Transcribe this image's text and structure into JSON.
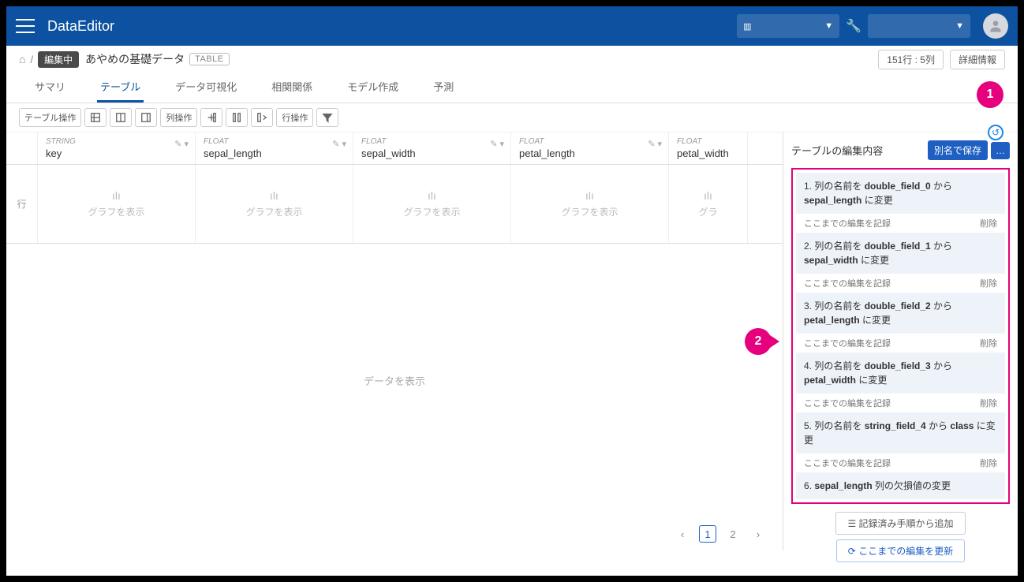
{
  "app": {
    "title": "DataEditor"
  },
  "breadcrumb": {
    "editing": "編集中",
    "dataset": "あやめの基礎データ",
    "type_badge": "TABLE"
  },
  "header_right": {
    "rowcol": "151行 : 5列",
    "detail": "詳細情報"
  },
  "tabs": {
    "summary": "サマリ",
    "table": "テーブル",
    "viz": "データ可視化",
    "corr": "相関関係",
    "model": "モデル作成",
    "predict": "予測"
  },
  "toolbar": {
    "table_ops": "テーブル操作",
    "col_ops": "列操作",
    "row_ops": "行操作"
  },
  "columns": [
    {
      "type": "STRING",
      "name": "key"
    },
    {
      "type": "FLOAT",
      "name": "sepal_length"
    },
    {
      "type": "FLOAT",
      "name": "sepal_width"
    },
    {
      "type": "FLOAT",
      "name": "petal_length"
    },
    {
      "type": "FLOAT",
      "name": "petal_width"
    }
  ],
  "row_label": "行",
  "graph_label": "グラフを表示",
  "data_placeholder": "データを表示",
  "side": {
    "title": "テーブルの編集内容",
    "save_as": "別名で保存",
    "more": "…",
    "record": "ここまでの編集を記録",
    "delete": "削除",
    "history": [
      {
        "n": "1.",
        "prefix": "列の名前を ",
        "old": "double_field_0",
        "mid": " から ",
        "new": "sepal_length",
        "suffix": " に変更",
        "has_actions": true
      },
      {
        "n": "2.",
        "prefix": "列の名前を ",
        "old": "double_field_1",
        "mid": " から ",
        "new": "sepal_width",
        "suffix": " に変更",
        "has_actions": true
      },
      {
        "n": "3.",
        "prefix": "列の名前を ",
        "old": "double_field_2",
        "mid": " から ",
        "new": "petal_length",
        "suffix": " に変更",
        "has_actions": true
      },
      {
        "n": "4.",
        "prefix": "列の名前を ",
        "old": "double_field_3",
        "mid": " から ",
        "new": "petal_width",
        "suffix": " に変更",
        "has_actions": true
      },
      {
        "n": "5.",
        "prefix": "列の名前を ",
        "old": "string_field_4",
        "mid": " から ",
        "new": "class",
        "suffix": " に変更",
        "has_actions": true
      },
      {
        "n": "6.",
        "prefix": "",
        "old": "sepal_length",
        "mid": "",
        "new": "",
        "suffix": " 列の欠損値の変更",
        "has_actions": false
      }
    ],
    "add_recorded": "記録済み手順から追加",
    "refresh": "ここまでの編集を更新"
  },
  "pagination": {
    "p1": "1",
    "p2": "2"
  },
  "callouts": {
    "c1": "1",
    "c2": "2"
  }
}
